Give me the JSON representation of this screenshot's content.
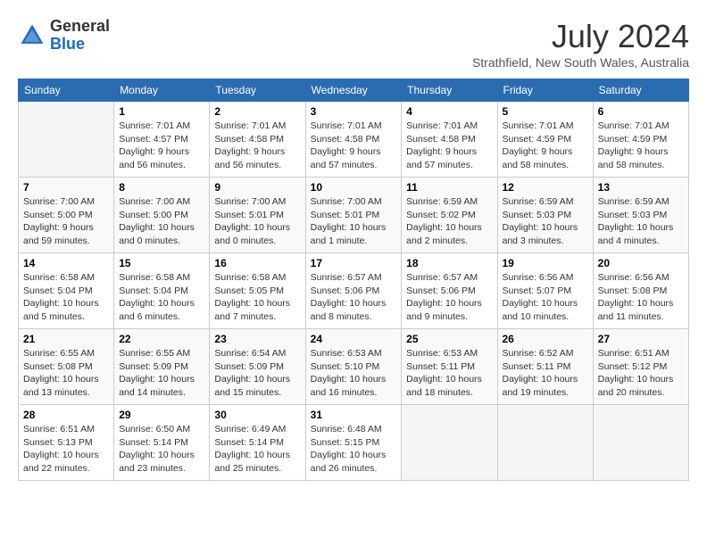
{
  "header": {
    "logo_general": "General",
    "logo_blue": "Blue",
    "month_title": "July 2024",
    "location": "Strathfield, New South Wales, Australia"
  },
  "days_of_week": [
    "Sunday",
    "Monday",
    "Tuesday",
    "Wednesday",
    "Thursday",
    "Friday",
    "Saturday"
  ],
  "weeks": [
    [
      {
        "day": null
      },
      {
        "day": 1,
        "sunrise": "7:01 AM",
        "sunset": "4:57 PM",
        "daylight": "9 hours and 56 minutes."
      },
      {
        "day": 2,
        "sunrise": "7:01 AM",
        "sunset": "4:58 PM",
        "daylight": "9 hours and 56 minutes."
      },
      {
        "day": 3,
        "sunrise": "7:01 AM",
        "sunset": "4:58 PM",
        "daylight": "9 hours and 57 minutes."
      },
      {
        "day": 4,
        "sunrise": "7:01 AM",
        "sunset": "4:58 PM",
        "daylight": "9 hours and 57 minutes."
      },
      {
        "day": 5,
        "sunrise": "7:01 AM",
        "sunset": "4:59 PM",
        "daylight": "9 hours and 58 minutes."
      },
      {
        "day": 6,
        "sunrise": "7:01 AM",
        "sunset": "4:59 PM",
        "daylight": "9 hours and 58 minutes."
      }
    ],
    [
      {
        "day": 7,
        "sunrise": "7:00 AM",
        "sunset": "5:00 PM",
        "daylight": "9 hours and 59 minutes."
      },
      {
        "day": 8,
        "sunrise": "7:00 AM",
        "sunset": "5:00 PM",
        "daylight": "10 hours and 0 minutes."
      },
      {
        "day": 9,
        "sunrise": "7:00 AM",
        "sunset": "5:01 PM",
        "daylight": "10 hours and 0 minutes."
      },
      {
        "day": 10,
        "sunrise": "7:00 AM",
        "sunset": "5:01 PM",
        "daylight": "10 hours and 1 minute."
      },
      {
        "day": 11,
        "sunrise": "6:59 AM",
        "sunset": "5:02 PM",
        "daylight": "10 hours and 2 minutes."
      },
      {
        "day": 12,
        "sunrise": "6:59 AM",
        "sunset": "5:03 PM",
        "daylight": "10 hours and 3 minutes."
      },
      {
        "day": 13,
        "sunrise": "6:59 AM",
        "sunset": "5:03 PM",
        "daylight": "10 hours and 4 minutes."
      }
    ],
    [
      {
        "day": 14,
        "sunrise": "6:58 AM",
        "sunset": "5:04 PM",
        "daylight": "10 hours and 5 minutes."
      },
      {
        "day": 15,
        "sunrise": "6:58 AM",
        "sunset": "5:04 PM",
        "daylight": "10 hours and 6 minutes."
      },
      {
        "day": 16,
        "sunrise": "6:58 AM",
        "sunset": "5:05 PM",
        "daylight": "10 hours and 7 minutes."
      },
      {
        "day": 17,
        "sunrise": "6:57 AM",
        "sunset": "5:06 PM",
        "daylight": "10 hours and 8 minutes."
      },
      {
        "day": 18,
        "sunrise": "6:57 AM",
        "sunset": "5:06 PM",
        "daylight": "10 hours and 9 minutes."
      },
      {
        "day": 19,
        "sunrise": "6:56 AM",
        "sunset": "5:07 PM",
        "daylight": "10 hours and 10 minutes."
      },
      {
        "day": 20,
        "sunrise": "6:56 AM",
        "sunset": "5:08 PM",
        "daylight": "10 hours and 11 minutes."
      }
    ],
    [
      {
        "day": 21,
        "sunrise": "6:55 AM",
        "sunset": "5:08 PM",
        "daylight": "10 hours and 13 minutes."
      },
      {
        "day": 22,
        "sunrise": "6:55 AM",
        "sunset": "5:09 PM",
        "daylight": "10 hours and 14 minutes."
      },
      {
        "day": 23,
        "sunrise": "6:54 AM",
        "sunset": "5:09 PM",
        "daylight": "10 hours and 15 minutes."
      },
      {
        "day": 24,
        "sunrise": "6:53 AM",
        "sunset": "5:10 PM",
        "daylight": "10 hours and 16 minutes."
      },
      {
        "day": 25,
        "sunrise": "6:53 AM",
        "sunset": "5:11 PM",
        "daylight": "10 hours and 18 minutes."
      },
      {
        "day": 26,
        "sunrise": "6:52 AM",
        "sunset": "5:11 PM",
        "daylight": "10 hours and 19 minutes."
      },
      {
        "day": 27,
        "sunrise": "6:51 AM",
        "sunset": "5:12 PM",
        "daylight": "10 hours and 20 minutes."
      }
    ],
    [
      {
        "day": 28,
        "sunrise": "6:51 AM",
        "sunset": "5:13 PM",
        "daylight": "10 hours and 22 minutes."
      },
      {
        "day": 29,
        "sunrise": "6:50 AM",
        "sunset": "5:14 PM",
        "daylight": "10 hours and 23 minutes."
      },
      {
        "day": 30,
        "sunrise": "6:49 AM",
        "sunset": "5:14 PM",
        "daylight": "10 hours and 25 minutes."
      },
      {
        "day": 31,
        "sunrise": "6:48 AM",
        "sunset": "5:15 PM",
        "daylight": "10 hours and 26 minutes."
      },
      {
        "day": null
      },
      {
        "day": null
      },
      {
        "day": null
      }
    ]
  ]
}
